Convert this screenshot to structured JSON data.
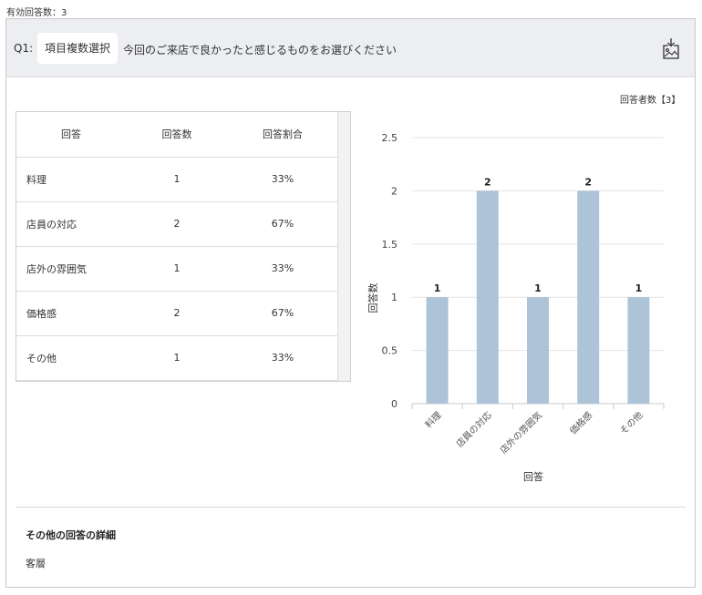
{
  "valid_responses_label": "有効回答数：3",
  "question": {
    "number": "Q1:",
    "type": "項目複数選択",
    "text": "今回のご来店で良かったと感じるものをお選びください"
  },
  "download_icon": "image-download-icon",
  "respondents_label": "回答者数【3】",
  "table": {
    "headers": [
      "回答",
      "回答数",
      "回答割合"
    ],
    "rows": [
      [
        "料理",
        "1",
        "33%"
      ],
      [
        "店員の対応",
        "2",
        "67%"
      ],
      [
        "店外の雰囲気",
        "1",
        "33%"
      ],
      [
        "価格感",
        "2",
        "67%"
      ],
      [
        "その他",
        "1",
        "33%"
      ]
    ]
  },
  "chart_data": {
    "type": "bar",
    "categories": [
      "料理",
      "店員の対応",
      "店外の雰囲気",
      "価格感",
      "その他"
    ],
    "values": [
      1,
      2,
      1,
      2,
      1
    ],
    "data_labels": [
      "1",
      "2",
      "1",
      "2",
      "1"
    ],
    "xlabel": "回答",
    "ylabel": "回答数",
    "ylim": [
      0,
      2.5
    ],
    "yticks": [
      0,
      0.5,
      1,
      1.5,
      2,
      2.5
    ],
    "ytick_labels": [
      "0",
      "0.5",
      "1",
      "1.5",
      "2",
      "2.5"
    ],
    "grid": true,
    "bar_color": "#adc4d8"
  },
  "other_details": {
    "title": "その他の回答の詳細",
    "items": [
      "客層"
    ]
  }
}
